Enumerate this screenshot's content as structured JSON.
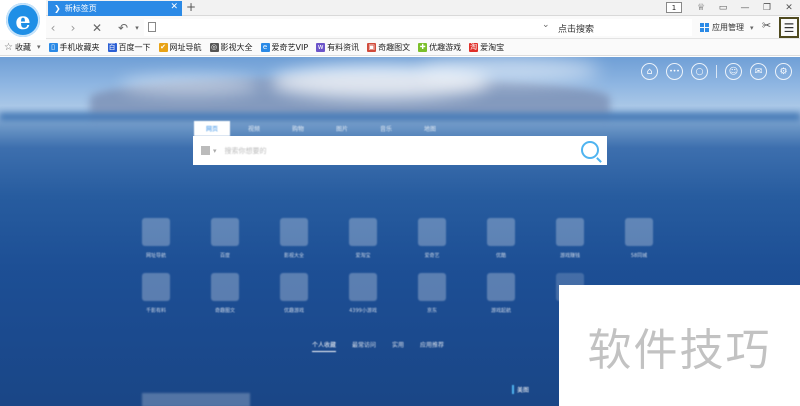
{
  "browser": {
    "tab": {
      "title": "新标签页",
      "icon": "❯",
      "close": "✕"
    },
    "new_tab": "+",
    "tab_count": "1",
    "nav": {
      "back": "‹",
      "forward": "›",
      "stop": "✕",
      "undo": "↶",
      "undo_dropdown": "▾"
    },
    "address": {
      "dropdown": "⌄",
      "search_label": "点击搜索"
    },
    "apps_label": "应用管理",
    "apps_dropdown": "▾",
    "window": {
      "shirt": "♕",
      "chat": "▭",
      "minimize": "—",
      "restore": "❐",
      "close": "✕"
    },
    "scissors": "✂",
    "menu": "☰"
  },
  "bookmarks": [
    {
      "label": "收藏",
      "icon": "☆",
      "color": "#666666"
    },
    {
      "label": "手机收藏夹",
      "icon": "▯",
      "color": "#2b8ae6"
    },
    {
      "label": "百度一下",
      "icon": "百",
      "color": "#2b5fd4"
    },
    {
      "label": "网址导航",
      "icon": "✔",
      "color": "#e8a317"
    },
    {
      "label": "影视大全",
      "icon": "◎",
      "color": "#555555"
    },
    {
      "label": "爱奇艺VIP",
      "icon": "e",
      "color": "#2b8ae6"
    },
    {
      "label": "有料资讯",
      "icon": "w",
      "color": "#6b54c9"
    },
    {
      "label": "奇趣图文",
      "icon": "▣",
      "color": "#d04a3a"
    },
    {
      "label": "优趣游戏",
      "icon": "✚",
      "color": "#7bbf2a"
    },
    {
      "label": "爱淘宝",
      "icon": "淘",
      "color": "#e0302a"
    }
  ],
  "page": {
    "top_icons": [
      "⌂",
      "•••",
      "○",
      "☺",
      "✉",
      "⚙"
    ],
    "search_tabs": [
      "网页",
      "视频",
      "购物",
      "图片",
      "音乐",
      "地图"
    ],
    "search_placeholder": "搜索你想要的",
    "tiles_row1": [
      "网址导航",
      "百度",
      "影视大全",
      "爱淘宝",
      "爱奇艺",
      "优酷",
      "游戏赚钱",
      "58同城"
    ],
    "tiles_row2": [
      "千影有料",
      "奇趣图文",
      "优趣游戏",
      "4399小游戏",
      "京东",
      "游戏起航"
    ],
    "bottom_tabs": [
      "个人收藏",
      "最常访问",
      "实用",
      "应用推荐"
    ],
    "corner_label": "美图"
  },
  "watermark": "软件技巧"
}
